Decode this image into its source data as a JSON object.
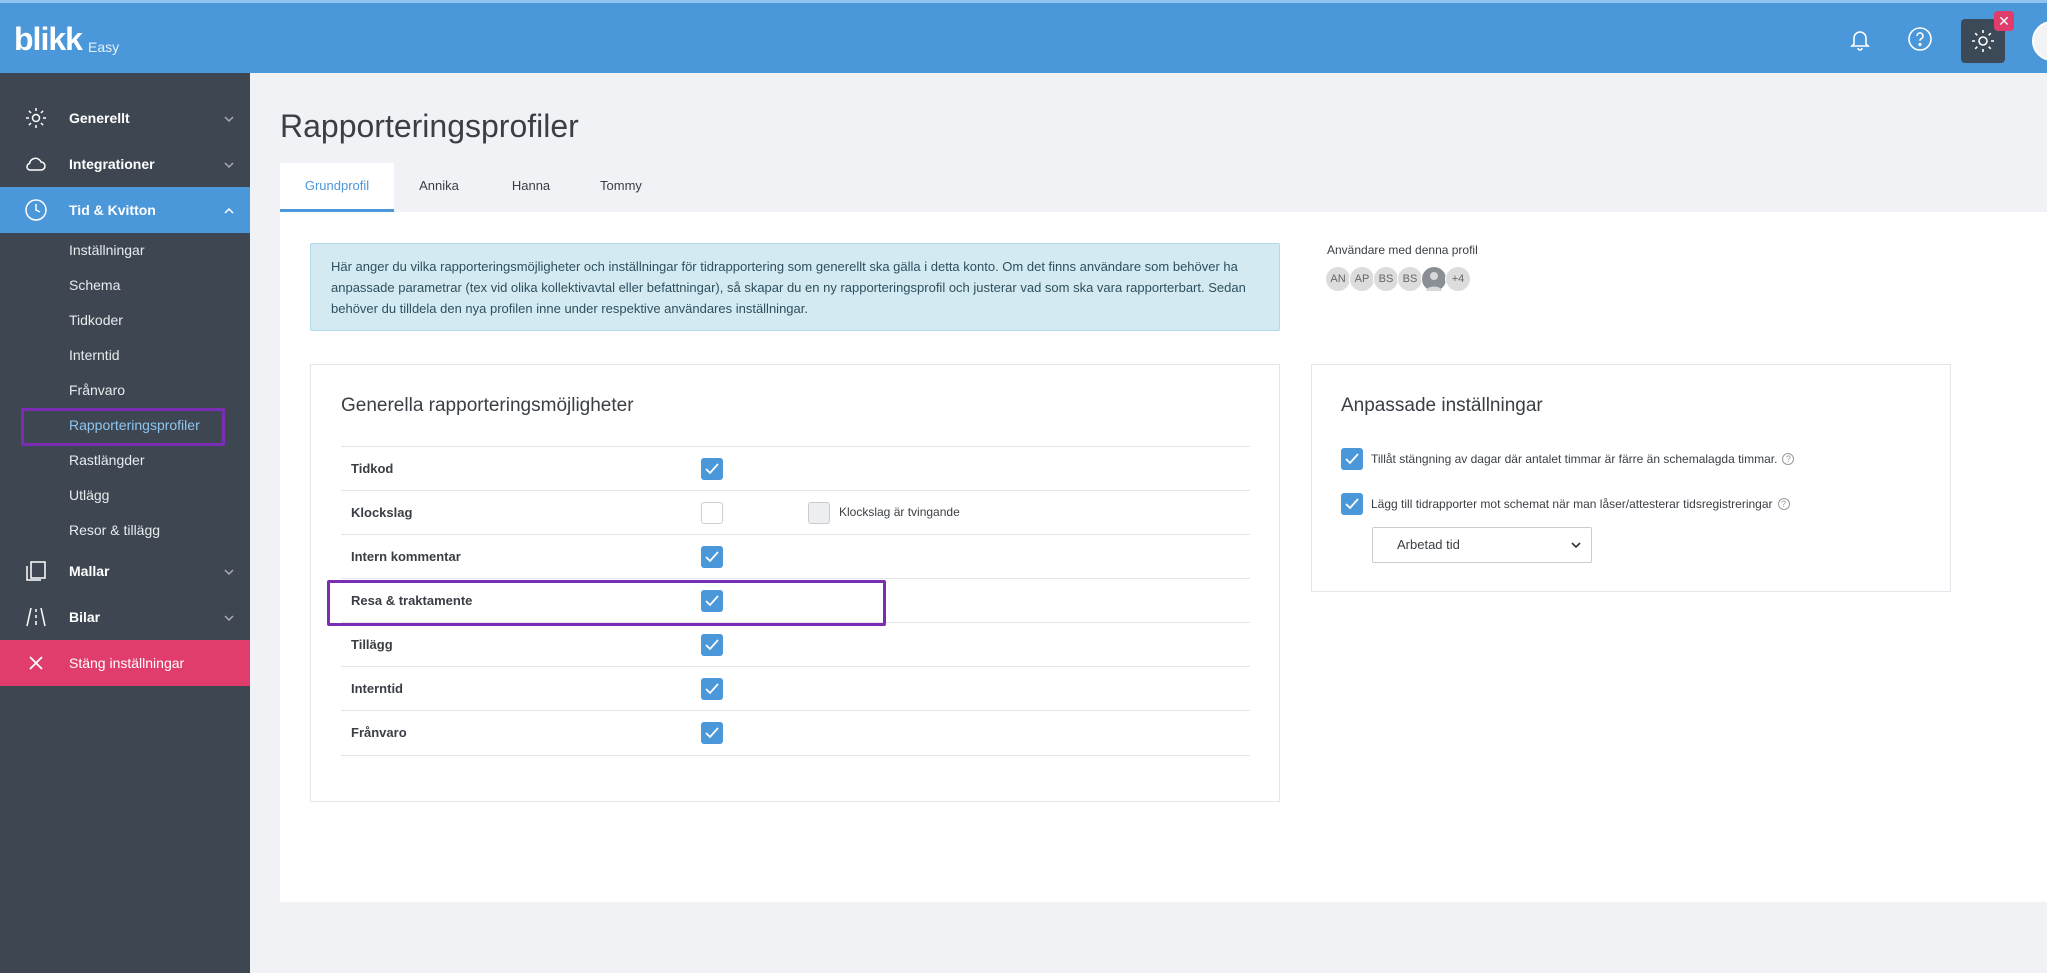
{
  "app": {
    "logo": "blikk",
    "logo_sub": "Easy"
  },
  "sidebar": {
    "items": [
      {
        "label": "Generellt",
        "icon": "gear-icon"
      },
      {
        "label": "Integrationer",
        "icon": "cloud-icon"
      },
      {
        "label": "Tid & Kvitton",
        "icon": "clock-icon"
      },
      {
        "label": "Mallar",
        "icon": "copy-icon"
      },
      {
        "label": "Bilar",
        "icon": "road-icon"
      },
      {
        "label": "Stäng inställningar",
        "icon": "close-icon"
      }
    ],
    "sub_items": [
      "Inställningar",
      "Schema",
      "Tidkoder",
      "Interntid",
      "Frånvaro",
      "Rapporteringsprofiler",
      "Rastlängder",
      "Utlägg",
      "Resor & tillägg"
    ]
  },
  "page": {
    "title": "Rapporteringsprofiler"
  },
  "tabs": [
    "Grundprofil",
    "Annika",
    "Hanna",
    "Tommy"
  ],
  "info_text": "Här anger du vilka rapporteringsmöjligheter och inställningar för tidrapportering som generellt ska gälla i detta konto. Om det finns användare som behöver ha anpassade parametrar (tex vid olika kollektivavtal eller befattningar), så skapar du en ny rapporteringsprofil och justerar vad som ska vara rapporterbart. Sedan behöver du tilldela den nya profilen inne under respektive användares inställningar.",
  "users": {
    "label": "Användare med denna profil",
    "avatars": [
      "AN",
      "AP",
      "BS",
      "BS",
      "",
      "+4"
    ]
  },
  "general": {
    "title": "Generella rapporteringsmöjligheter",
    "rows": [
      {
        "label": "Tidkod",
        "checked": true
      },
      {
        "label": "Klockslag",
        "checked": false,
        "extra_label": "Klockslag är tvingande"
      },
      {
        "label": "Intern kommentar",
        "checked": true
      },
      {
        "label": "Resa & traktamente",
        "checked": true
      },
      {
        "label": "Tillägg",
        "checked": true
      },
      {
        "label": "Interntid",
        "checked": true
      },
      {
        "label": "Frånvaro",
        "checked": true
      }
    ]
  },
  "custom": {
    "title": "Anpassade inställningar",
    "options": [
      {
        "label": "Tillåt stängning av dagar där antalet timmar är färre än schemalagda timmar.",
        "checked": true
      },
      {
        "label": "Lägg till tidrapporter mot schemat när man låser/attesterar tidsregistreringar",
        "checked": true
      }
    ],
    "select_value": "Arbetad tid"
  },
  "colors": {
    "primary": "#4a97d9",
    "sidebar": "#3e4751",
    "danger": "#e03d6c",
    "highlight": "#7b2db3"
  }
}
